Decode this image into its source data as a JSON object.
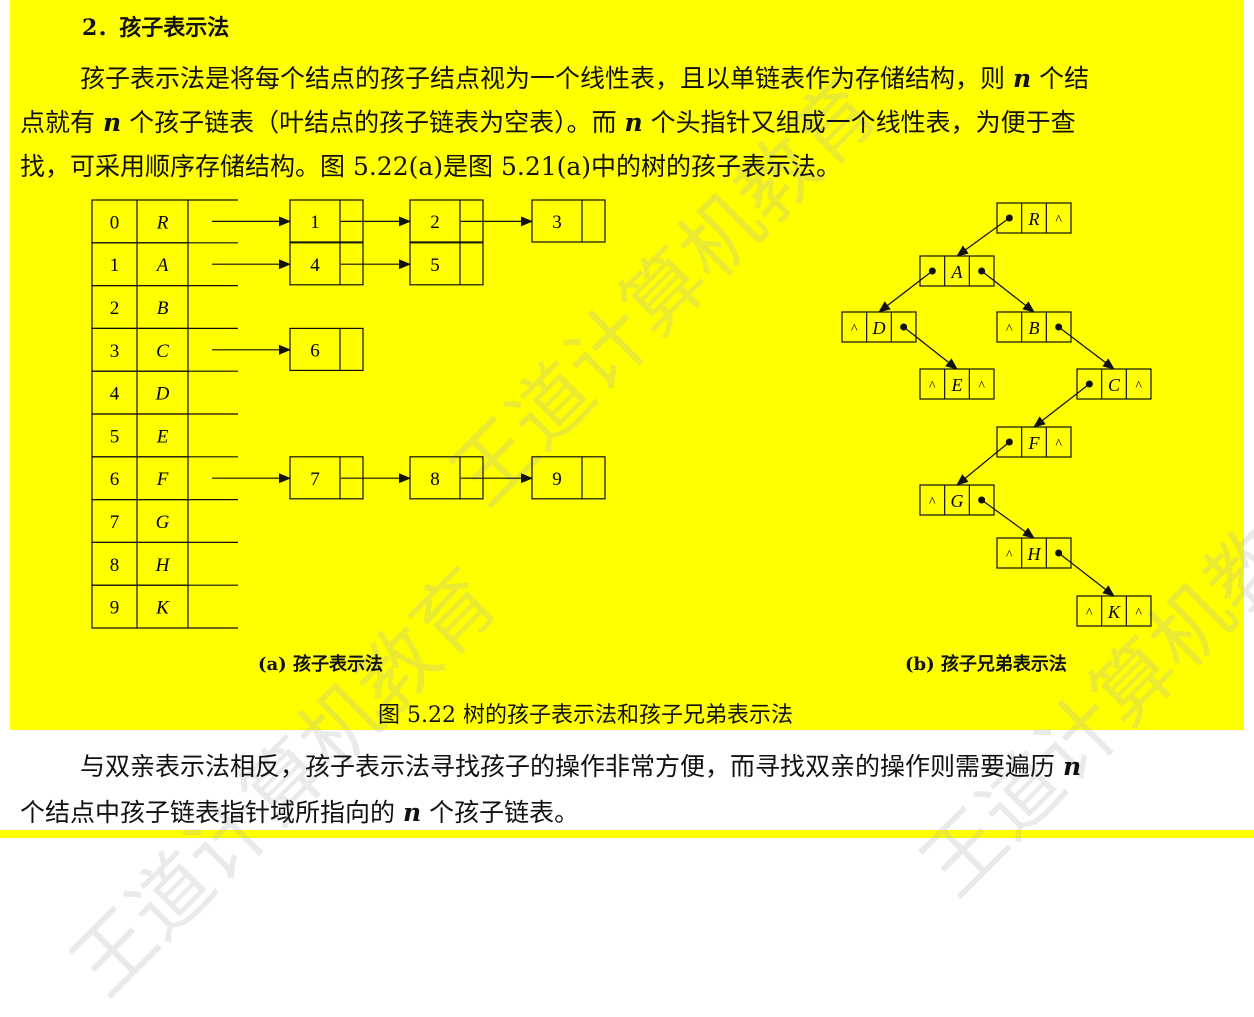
{
  "section": {
    "heading": "2．孩子表示法"
  },
  "paragraph1": {
    "line1_a": "孩子表示法是将每个结点的孩子结点视为一个线性表，且以单链表作为存储结构，则 ",
    "n": "n",
    "line1_b": " 个结",
    "line2_a": "点就有 ",
    "line2_b": " 个孩子链表（叶结点的孩子链表为空表）。而 ",
    "line2_c": " 个头指针又组成一个线性表，为便于查",
    "line3": "找，可采用顺序存储结构。图 5.22(a)是图 5.21(a)中的树的孩子表示法。"
  },
  "figure_a": {
    "table": [
      {
        "index": "0",
        "name": "R"
      },
      {
        "index": "1",
        "name": "A"
      },
      {
        "index": "2",
        "name": "B"
      },
      {
        "index": "3",
        "name": "C"
      },
      {
        "index": "4",
        "name": "D"
      },
      {
        "index": "5",
        "name": "E"
      },
      {
        "index": "6",
        "name": "F"
      },
      {
        "index": "7",
        "name": "G"
      },
      {
        "index": "8",
        "name": "H"
      },
      {
        "index": "9",
        "name": "K"
      }
    ],
    "child_lists": [
      {
        "row": 0,
        "children": [
          "1",
          "2",
          "3"
        ]
      },
      {
        "row": 1,
        "children": [
          "4",
          "5"
        ]
      },
      {
        "row": 3,
        "children": [
          "6"
        ]
      },
      {
        "row": 6,
        "children": [
          "7",
          "8",
          "9"
        ]
      }
    ],
    "caption": "(a)  孩子表示法"
  },
  "figure_b": {
    "nodes": [
      {
        "id": "R",
        "left_null": false,
        "right_null": true
      },
      {
        "id": "A",
        "left_null": false,
        "right_null": false
      },
      {
        "id": "D",
        "left_null": true,
        "right_null": false
      },
      {
        "id": "B",
        "left_null": true,
        "right_null": false
      },
      {
        "id": "E",
        "left_null": true,
        "right_null": true
      },
      {
        "id": "C",
        "left_null": false,
        "right_null": true
      },
      {
        "id": "F",
        "left_null": false,
        "right_null": true
      },
      {
        "id": "G",
        "left_null": true,
        "right_null": false
      },
      {
        "id": "H",
        "left_null": true,
        "right_null": false
      },
      {
        "id": "K",
        "left_null": true,
        "right_null": true
      }
    ],
    "null_symbol": "^",
    "caption": "(b)  孩子兄弟表示法"
  },
  "figure_caption": "图 5.22    树的孩子表示法和孩子兄弟表示法",
  "paragraph2": {
    "line1_a": "与双亲表示法相反，孩子表示法寻找孩子的操作非常方便，而寻找双亲的操作则需要遍历 ",
    "line2_a": "个结点中孩子链表指针域所指向的 ",
    "line2_b": " 个孩子链表。"
  },
  "watermark": "王道计算机教育",
  "colors": {
    "highlight": "#ffff00",
    "ink": "#111111"
  }
}
